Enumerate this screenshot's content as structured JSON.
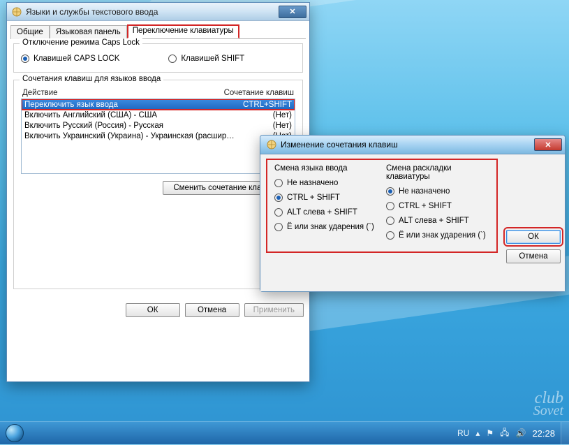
{
  "dialog1": {
    "title": "Языки и службы текстового ввода",
    "tabs": [
      "Общие",
      "Языковая панель",
      "Переключение клавиатуры"
    ],
    "active_tab": 2,
    "caps_group_title": "Отключение режима Caps Lock",
    "caps_option1": "Клавишей CAPS LOCK",
    "caps_option2": "Клавишей SHIFT",
    "combo_group_title": "Сочетания клавиш для языков ввода",
    "col_action": "Действие",
    "col_combo": "Сочетание клавиш",
    "items": [
      {
        "action": "Переключить язык ввода",
        "combo": "CTRL+SHIFT",
        "selected": true
      },
      {
        "action": "Включить Английский (США) - США",
        "combo": "(Нет)",
        "selected": false
      },
      {
        "action": "Включить Русский (Россия) - Русская",
        "combo": "(Нет)",
        "selected": false
      },
      {
        "action": "Включить Украинский (Украина) - Украинская (расшир…",
        "combo": "(Нет)",
        "selected": false
      }
    ],
    "change_btn": "Сменить сочетание клавиш…",
    "ok": "ОК",
    "cancel": "Отмена",
    "apply": "Применить"
  },
  "dialog2": {
    "title": "Изменение сочетания клавиш",
    "left_title": "Смена языка ввода",
    "right_title": "Смена раскладки клавиатуры",
    "options": [
      "Не назначено",
      "CTRL + SHIFT",
      "ALT слева + SHIFT",
      "Ё или знак ударения (`)"
    ],
    "left_selected": 1,
    "right_selected": 0,
    "ok": "ОК",
    "cancel": "Отмена"
  },
  "taskbar": {
    "lang": "RU",
    "time": "22:28"
  },
  "watermark": {
    "l1": "club",
    "l2": "Sovet"
  }
}
